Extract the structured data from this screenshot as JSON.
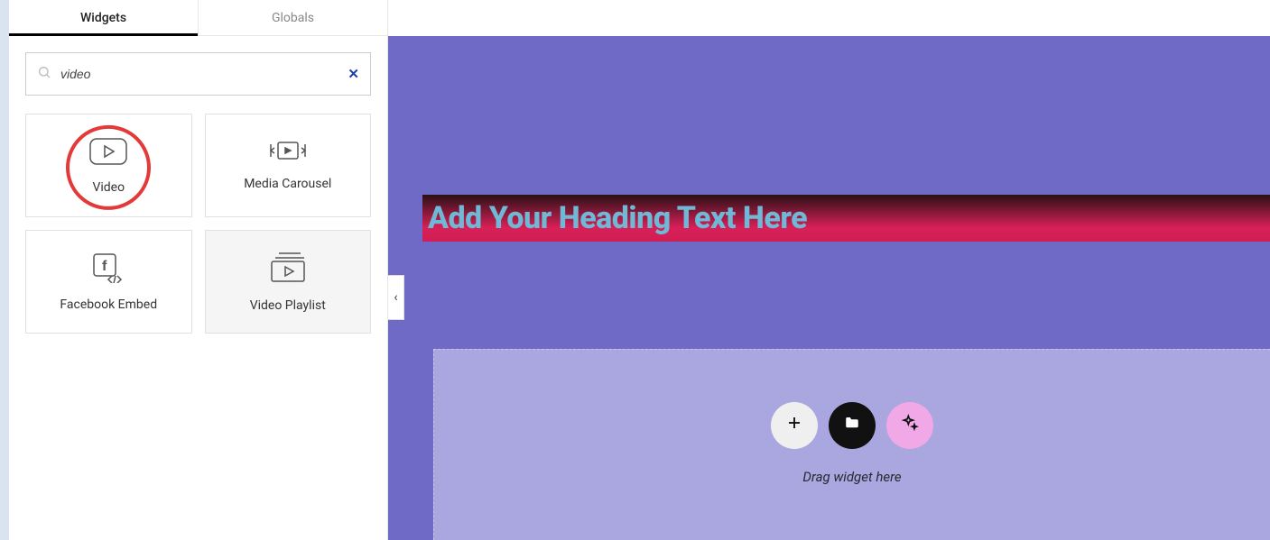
{
  "sidebar": {
    "tabs": {
      "widgets": "Widgets",
      "globals": "Globals"
    },
    "search": {
      "value": "video"
    },
    "widgets": [
      {
        "name": "Video"
      },
      {
        "name": "Media Carousel"
      },
      {
        "name": "Facebook Embed"
      },
      {
        "name": "Video Playlist"
      }
    ]
  },
  "canvas": {
    "heading_placeholder": "Add Your Heading Text Here",
    "dropzone_hint": "Drag widget here"
  },
  "colors": {
    "canvas_bg": "#6e6ac6",
    "heading_text": "#6fb9d6",
    "highlight_ring": "#e33939"
  }
}
